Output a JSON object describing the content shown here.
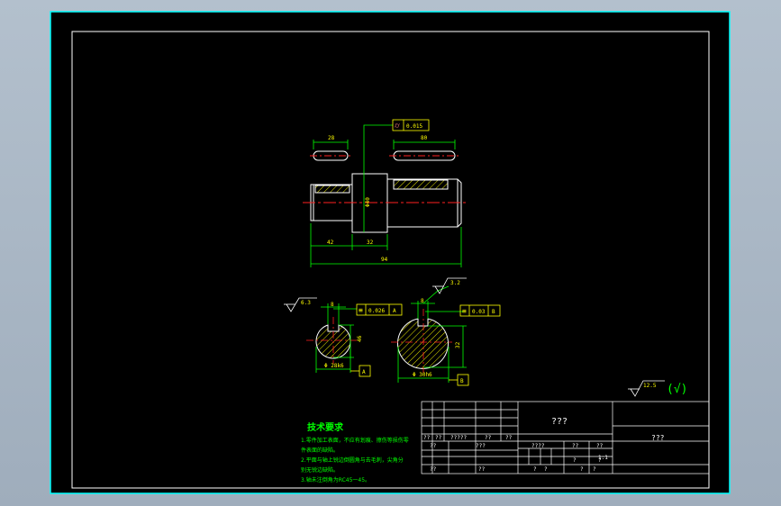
{
  "colors": {
    "background": "#000000",
    "frame": "#00ffff",
    "geometry": "#ffffff",
    "dimension": "#00ff00",
    "centerline": "#ff2020",
    "hatch": "#e8e800",
    "callout": "#ffff00",
    "title_block": "#ffffff"
  },
  "top_view": {
    "dim_keyway_left": "28",
    "dim_keyway_right": "80",
    "dim_diameter": "Φ40",
    "dim_len_left": "42",
    "dim_len_mid": "32",
    "dim_total": "94",
    "tol_symbol": "⌭",
    "tol_value": "0.015"
  },
  "section_left": {
    "roughness": "6.3",
    "key_width": "8",
    "tol_symbol": "≡",
    "tol_value": "0.026",
    "tol_datum": "A",
    "dim_height": "46",
    "dim_diameter": "Φ 28k6",
    "datum": "A"
  },
  "section_right": {
    "roughness": "3.2",
    "key_width": "8",
    "tol_symbol": "≡",
    "tol_value": "0.03",
    "tol_datum": "B",
    "dim_height": "32",
    "dim_diameter": "Φ 30h6",
    "datum": "B"
  },
  "general_roughness": {
    "value": "12.5",
    "mark": "(√)"
  },
  "tech_requirements": {
    "title": "技术要求",
    "lines": [
      "1.零件加工表面，不应有划痕、擦伤等损伤零",
      "件表面的缺陷。",
      "2.平面与轴上锐边倒圆角与去毛刺，尖角分",
      "别无锐边缺陷。",
      "3.轴未注倒角为RC45一45。"
    ]
  },
  "title_block": {
    "drawing_name": "???",
    "company": "???",
    "cells": {
      "r4_c1": "??",
      "r4_c2": "??",
      "r4_c3": "?????",
      "r4_c4": "??",
      "r4_c5": "??",
      "r5_c1": "??",
      "r5_c3": "???",
      "r5_c6": "????",
      "r5_c7": "??",
      "r5_c8": "??",
      "r6_c6": "?",
      "r6_c7": "?",
      "r6_scale": "1:1",
      "r7_c1": "??",
      "r7_c3": "??",
      "r7_c6": "?",
      "r7_c7": "?",
      "r7_c8": "?",
      "r7_c9": "?"
    }
  }
}
